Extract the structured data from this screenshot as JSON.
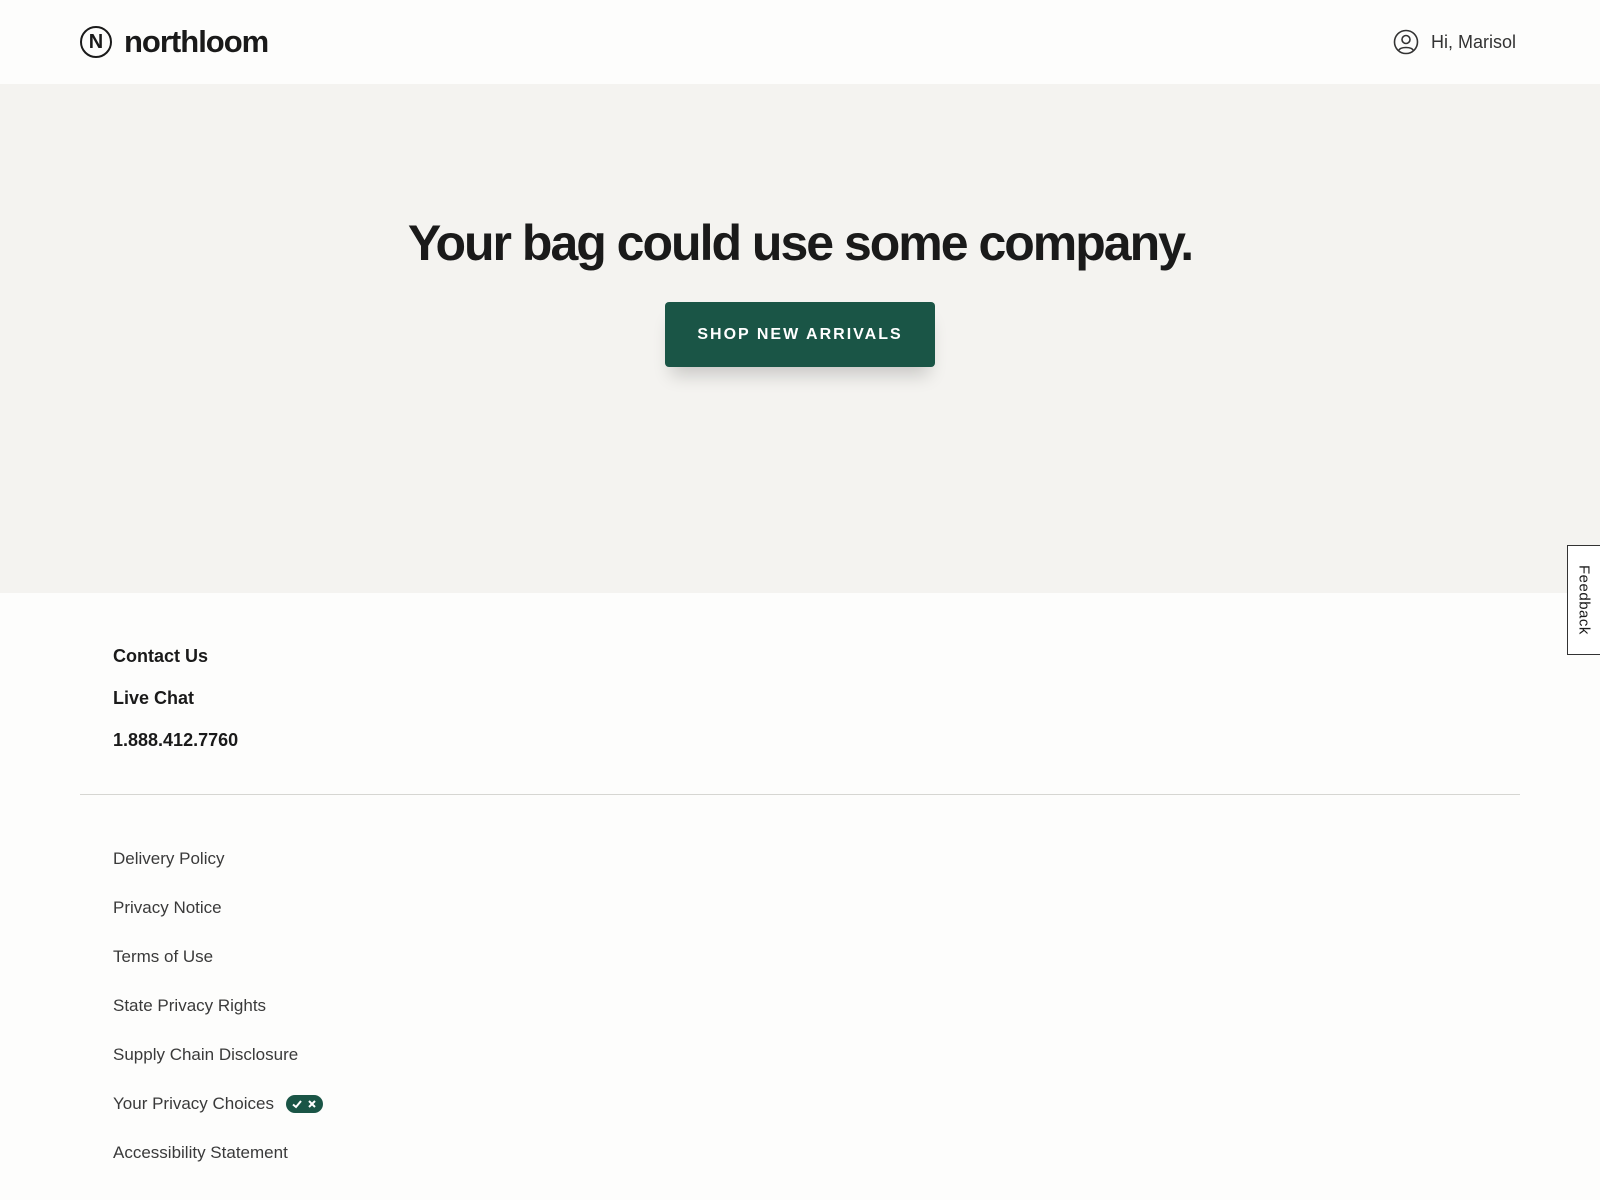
{
  "header": {
    "logo_mark": "N",
    "logo_text": "northloom",
    "account_greeting": "Hi, Marisol",
    "account_icon": "user-circle-icon"
  },
  "hero": {
    "title": "Your bag could use some company.",
    "cta_label": "SHOP NEW ARRIVALS"
  },
  "feedback_tab": {
    "label": "Feedback"
  },
  "contact": {
    "items": [
      "Contact Us",
      "Live Chat",
      "1.888.412.7760"
    ]
  },
  "legal": {
    "items": [
      "Delivery Policy",
      "Privacy Notice",
      "Terms of Use",
      "State Privacy Rights",
      "Supply Chain Disclosure",
      "Your Privacy Choices",
      "Accessibility Statement"
    ],
    "privacy_choices_icon": "privacy-toggle-icon"
  },
  "colors": {
    "brand_green": "#1a5546",
    "hero_background": "#f4f3f0",
    "page_background": "#fdfdfc",
    "text_primary": "#1a1a1a"
  }
}
